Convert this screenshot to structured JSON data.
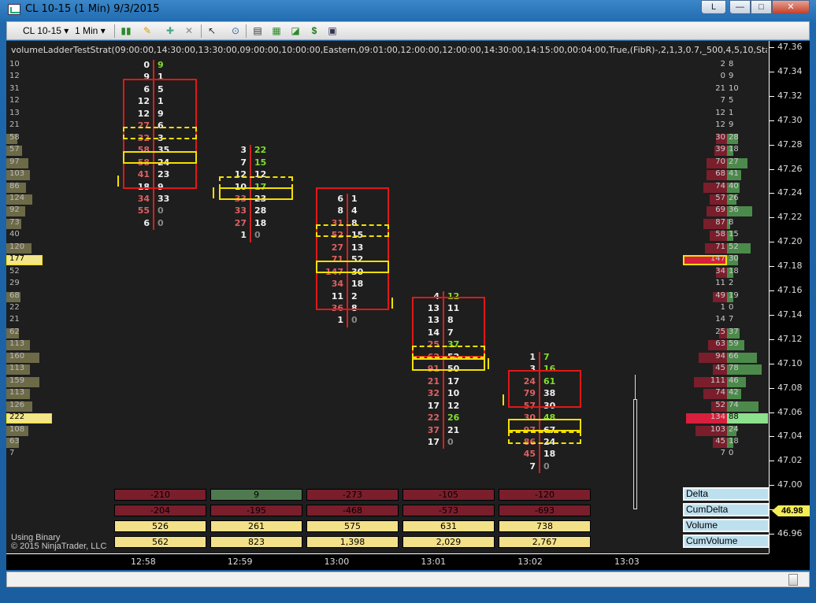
{
  "window": {
    "title": "CL 10-15 (1 Min)  9/3/2015",
    "link_label": "L",
    "min_label": "—",
    "max_label": "□",
    "close_label": "✕"
  },
  "toolbar": {
    "instrument": "CL 10-15",
    "interval": "1 Min",
    "icons": [
      "bar-style-icon",
      "pencil-icon",
      "plus-marker-icon",
      "minus-marker-icon",
      "cursor-icon",
      "zoom-icon",
      "data-box-icon",
      "strategy-icon",
      "chart-trader-icon",
      "dollar-icon",
      "properties-icon"
    ]
  },
  "chart": {
    "strategy_label": "volumeLadderTestStrat(09:00:00,14:30:00,13:30:00,09:00:00,10:00:00,Eastern,09:01:00,12:00:00,12:00:00,14:30:00,14:15:00,00:04:00,True,(FibR)-,2,1,3,0.7,_500,4,5,10,Standard,False,_382,_618,(",
    "using": "Using Binary",
    "copyright": "© 2015 NinjaTrader, LLC",
    "last_price": "46.98",
    "price_ticks": [
      "47.36",
      "47.34",
      "47.32",
      "47.30",
      "47.28",
      "47.26",
      "47.24",
      "47.22",
      "47.20",
      "47.18",
      "47.16",
      "47.14",
      "47.12",
      "47.10",
      "47.08",
      "47.06",
      "47.04",
      "47.02",
      "47.00",
      "46.98",
      "46.96"
    ],
    "time_ticks": [
      "12:58",
      "12:59",
      "13:00",
      "13:01",
      "13:02",
      "13:03"
    ],
    "left_profile": [
      {
        "v": "10",
        "w": 0
      },
      {
        "v": "12",
        "w": 0
      },
      {
        "v": "31",
        "w": 0
      },
      {
        "v": "12",
        "w": 0
      },
      {
        "v": "13",
        "w": 0
      },
      {
        "v": "21",
        "w": 0
      },
      {
        "v": "58",
        "w": 14
      },
      {
        "v": "57",
        "w": 20
      },
      {
        "v": "97",
        "w": 28
      },
      {
        "v": "103",
        "w": 30
      },
      {
        "v": "86",
        "w": 25
      },
      {
        "v": "124",
        "w": 33
      },
      {
        "v": "92",
        "w": 24
      },
      {
        "v": "73",
        "w": 19
      },
      {
        "v": "40",
        "w": 0
      },
      {
        "v": "120",
        "w": 32
      },
      {
        "v": "177",
        "w": 46
      },
      {
        "v": "52",
        "w": 0
      },
      {
        "v": "29",
        "w": 0
      },
      {
        "v": "68",
        "w": 18
      },
      {
        "v": "22",
        "w": 0
      },
      {
        "v": "21",
        "w": 0
      },
      {
        "v": "62",
        "w": 16
      },
      {
        "v": "113",
        "w": 30
      },
      {
        "v": "160",
        "w": 42
      },
      {
        "v": "113",
        "w": 30
      },
      {
        "v": "159",
        "w": 42
      },
      {
        "v": "113",
        "w": 30
      },
      {
        "v": "126",
        "w": 33
      },
      {
        "v": "222",
        "w": 58
      },
      {
        "v": "108",
        "w": 28
      },
      {
        "v": "63",
        "w": 16
      },
      {
        "v": "7",
        "w": 0
      }
    ],
    "right_profile": [
      {
        "b": "2",
        "a": "8",
        "bw": 0,
        "aw": 0
      },
      {
        "b": "0",
        "a": "9",
        "bw": 0,
        "aw": 0
      },
      {
        "b": "21",
        "a": "10",
        "bw": 0,
        "aw": 0
      },
      {
        "b": "7",
        "a": "5",
        "bw": 0,
        "aw": 0
      },
      {
        "b": "12",
        "a": "1",
        "bw": 0,
        "aw": 0
      },
      {
        "b": "12",
        "a": "9",
        "bw": 0,
        "aw": 0
      },
      {
        "b": "30",
        "a": "28",
        "bw": 14,
        "aw": 14
      },
      {
        "b": "39",
        "a": "18",
        "bw": 16,
        "aw": 8
      },
      {
        "b": "70",
        "a": "27",
        "bw": 26,
        "aw": 26
      },
      {
        "b": "68",
        "a": "41",
        "bw": 26,
        "aw": 18
      },
      {
        "b": "74",
        "a": "40",
        "bw": 30,
        "aw": 16
      },
      {
        "b": "57",
        "a": "26",
        "bw": 22,
        "aw": 12
      },
      {
        "b": "69",
        "a": "36",
        "bw": 26,
        "aw": 32
      },
      {
        "b": "87",
        "a": "8",
        "bw": 30,
        "aw": 4
      },
      {
        "b": "58",
        "a": "15",
        "bw": 22,
        "aw": 8
      },
      {
        "b": "71",
        "a": "52",
        "bw": 28,
        "aw": 30
      },
      {
        "b": "147",
        "a": "30",
        "bw": 56,
        "aw": 14
      },
      {
        "b": "34",
        "a": "18",
        "bw": 14,
        "aw": 8
      },
      {
        "b": "11",
        "a": "2",
        "bw": 0,
        "aw": 0
      },
      {
        "b": "49",
        "a": "19",
        "bw": 18,
        "aw": 8
      },
      {
        "b": "1",
        "a": "0",
        "bw": 0,
        "aw": 0
      },
      {
        "b": "14",
        "a": "7",
        "bw": 0,
        "aw": 0
      },
      {
        "b": "25",
        "a": "37",
        "bw": 10,
        "aw": 16
      },
      {
        "b": "63",
        "a": "59",
        "bw": 24,
        "aw": 22
      },
      {
        "b": "94",
        "a": "66",
        "bw": 36,
        "aw": 38
      },
      {
        "b": "45",
        "a": "78",
        "bw": 18,
        "aw": 44
      },
      {
        "b": "111",
        "a": "46",
        "bw": 42,
        "aw": 24
      },
      {
        "b": "74",
        "a": "42",
        "bw": 30,
        "aw": 18
      },
      {
        "b": "52",
        "a": "74",
        "bw": 20,
        "aw": 40
      },
      {
        "b": "134",
        "a": "88",
        "bw": 52,
        "aw": 52
      },
      {
        "b": "103",
        "a": "24",
        "bw": 40,
        "aw": 12
      },
      {
        "b": "45",
        "a": "18",
        "bw": 18,
        "aw": 8
      },
      {
        "b": "7",
        "a": "0",
        "bw": 0,
        "aw": 0
      }
    ],
    "summary_labels": [
      "Delta",
      "CumDelta",
      "Volume",
      "CumVolume"
    ],
    "summary": [
      {
        "delta": "-210",
        "cumdelta": "-204",
        "volume": "526",
        "cumvolume": "562",
        "dcol": "#7a1e2c"
      },
      {
        "delta": "9",
        "cumdelta": "-195",
        "volume": "261",
        "cumvolume": "823",
        "dcol": "#4f7a4f"
      },
      {
        "delta": "-273",
        "cumdelta": "-468",
        "volume": "575",
        "cumvolume": "1,398",
        "dcol": "#7a1e2c"
      },
      {
        "delta": "-105",
        "cumdelta": "-573",
        "volume": "631",
        "cumvolume": "2,029",
        "dcol": "#7a1e2c"
      },
      {
        "delta": "-120",
        "cumdelta": "-693",
        "volume": "738",
        "cumvolume": "2,767",
        "dcol": "#7a1e2c"
      }
    ],
    "bars": [
      {
        "time": "12:58",
        "rows": [
          [
            "0",
            "9"
          ],
          [
            "9",
            "1"
          ],
          [
            "6",
            "5"
          ],
          [
            "12",
            "1"
          ],
          [
            "12",
            "9"
          ],
          [
            "27",
            "6"
          ],
          [
            "32",
            "3"
          ],
          [
            "58",
            "35"
          ],
          [
            "58",
            "24"
          ],
          [
            "41",
            "23"
          ],
          [
            "18",
            "9"
          ],
          [
            "34",
            "33"
          ],
          [
            "55",
            "0"
          ],
          [
            "6",
            "0"
          ]
        ],
        "start": 0
      },
      {
        "time": "12:59",
        "rows": [
          [
            "3",
            "22"
          ],
          [
            "7",
            "15"
          ],
          [
            "12",
            "12"
          ],
          [
            "10",
            "17"
          ],
          [
            "33",
            "23"
          ],
          [
            "33",
            "28"
          ],
          [
            "27",
            "18"
          ],
          [
            "1",
            "0"
          ]
        ],
        "start": 7
      },
      {
        "time": "13:00",
        "rows": [
          [
            "6",
            "1"
          ],
          [
            "8",
            "4"
          ],
          [
            "31",
            "8"
          ],
          [
            "52",
            "15"
          ],
          [
            "27",
            "13"
          ],
          [
            "71",
            "52"
          ],
          [
            "147",
            "30"
          ],
          [
            "34",
            "18"
          ],
          [
            "11",
            "2"
          ],
          [
            "36",
            "8"
          ],
          [
            "1",
            "0"
          ]
        ],
        "start": 11
      },
      {
        "time": "13:01",
        "rows": [
          [
            "4",
            "12"
          ],
          [
            "13",
            "11"
          ],
          [
            "13",
            "8"
          ],
          [
            "14",
            "7"
          ],
          [
            "25",
            "37"
          ],
          [
            "62",
            "52"
          ],
          [
            "91",
            "50"
          ],
          [
            "21",
            "17"
          ],
          [
            "32",
            "10"
          ],
          [
            "17",
            "12"
          ],
          [
            "22",
            "26"
          ],
          [
            "37",
            "21"
          ],
          [
            "17",
            "0"
          ]
        ],
        "start": 19
      },
      {
        "time": "13:02",
        "rows": [
          [
            "1",
            "7"
          ],
          [
            "3",
            "16"
          ],
          [
            "24",
            "61"
          ],
          [
            "79",
            "38"
          ],
          [
            "57",
            "30"
          ],
          [
            "30",
            "48"
          ],
          [
            "97",
            "67"
          ],
          [
            "86",
            "24"
          ],
          [
            "45",
            "18"
          ],
          [
            "7",
            "0"
          ]
        ],
        "start": 24
      }
    ]
  }
}
